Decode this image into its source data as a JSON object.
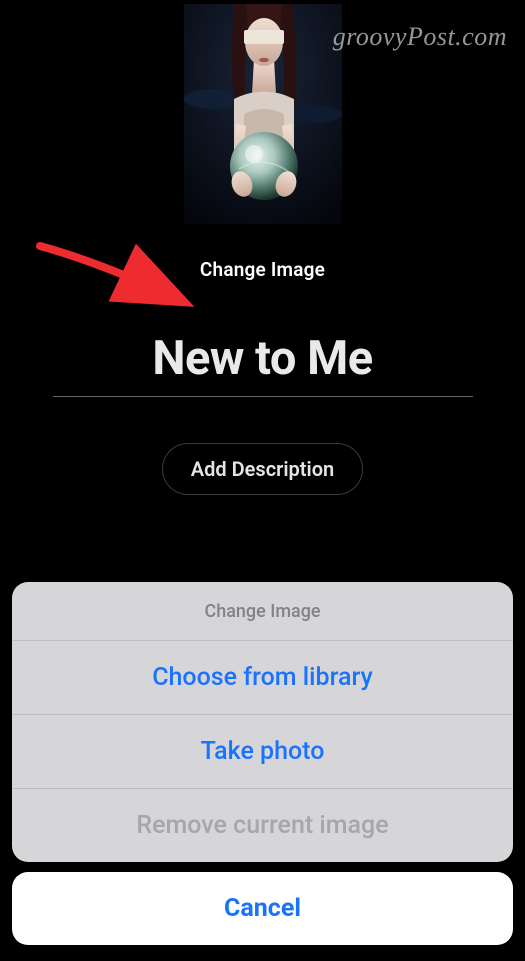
{
  "watermark": "groovyPost.com",
  "changeImageLabel": "Change Image",
  "titleValue": "New to Me",
  "addDescriptionLabel": "Add Description",
  "actionSheet": {
    "title": "Change Image",
    "options": [
      {
        "label": "Choose from library",
        "enabled": true
      },
      {
        "label": "Take photo",
        "enabled": true
      },
      {
        "label": "Remove current image",
        "enabled": false
      }
    ],
    "cancelLabel": "Cancel"
  },
  "colors": {
    "background": "#000000",
    "iosBlue": "#1a73ff",
    "sheetBg": "#d6d6d8",
    "arrow": "#ee2b2f"
  }
}
